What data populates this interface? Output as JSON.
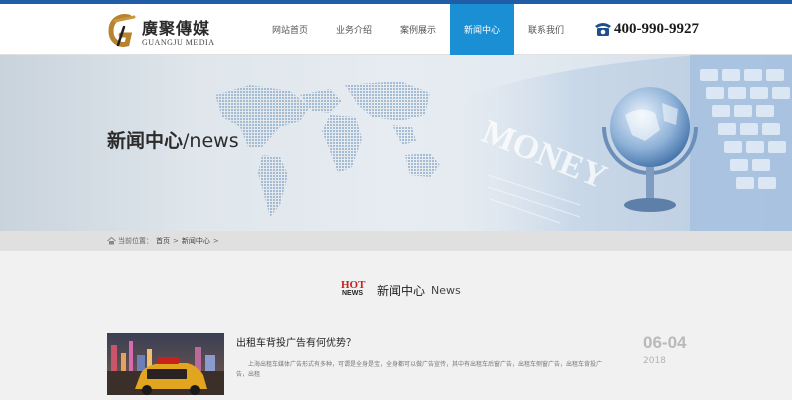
{
  "header": {
    "logo_cn": "廣聚傳媒",
    "logo_en": "GUANGJU MEDIA",
    "nav": [
      {
        "label": "网站首页",
        "active": false
      },
      {
        "label": "业务介绍",
        "active": false
      },
      {
        "label": "案例展示",
        "active": false
      },
      {
        "label": "新闻中心",
        "active": true
      },
      {
        "label": "联系我们",
        "active": false
      }
    ],
    "phone": "400-990-9927"
  },
  "banner": {
    "title_cn": "新闻中心",
    "title_en": "/news",
    "money_text": "MONEY"
  },
  "breadcrumb": {
    "prefix": "当前位置：",
    "items": [
      "首页",
      "新闻中心"
    ],
    "sep": ">"
  },
  "section": {
    "hot_top": "HOT",
    "hot_bottom": "NEWS",
    "title_cn": "新闻中心",
    "title_en": "News"
  },
  "news": {
    "title": "出租车背投广告有何优势？",
    "excerpt": "上海出租车媒体广告形式有多种，可谓是全身是宝，全身都可以做广告宣传，其中有出租车后窗广告，出租车侧窗广告，出租车背投广告，出租",
    "date_day": "06-04",
    "date_year": "2018"
  },
  "colors": {
    "accent": "#1b8fd3",
    "topline": "#1f5ea6",
    "hot_red": "#c8201d"
  }
}
